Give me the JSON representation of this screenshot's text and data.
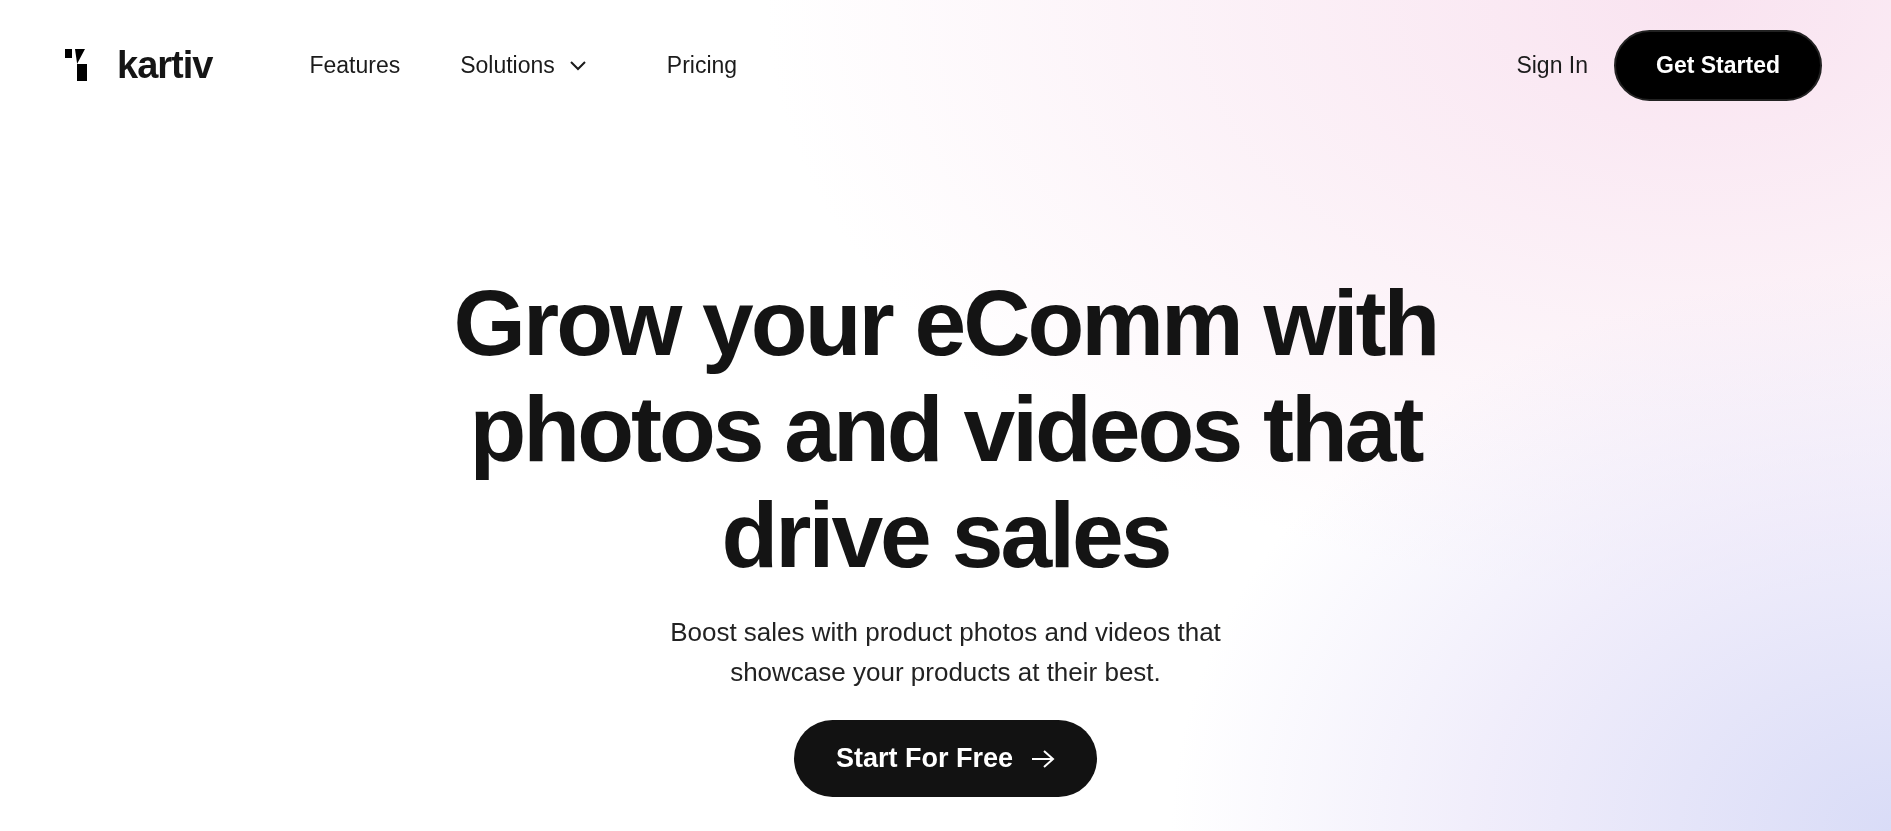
{
  "brand": {
    "name": "kartiv"
  },
  "nav": [
    {
      "label": "Features",
      "kind": "link"
    },
    {
      "label": "Solutions",
      "kind": "dropdown"
    },
    {
      "label": "Pricing",
      "kind": "link"
    }
  ],
  "sign_in": "Sign In",
  "cta": "Get Started",
  "hero": {
    "headline": [
      "Grow your eComm with",
      "photos and videos that",
      "drive sales"
    ],
    "subtitle": [
      "Boost sales with product photos and videos that",
      "showcase your products at their best."
    ],
    "button": "Start For Free"
  }
}
